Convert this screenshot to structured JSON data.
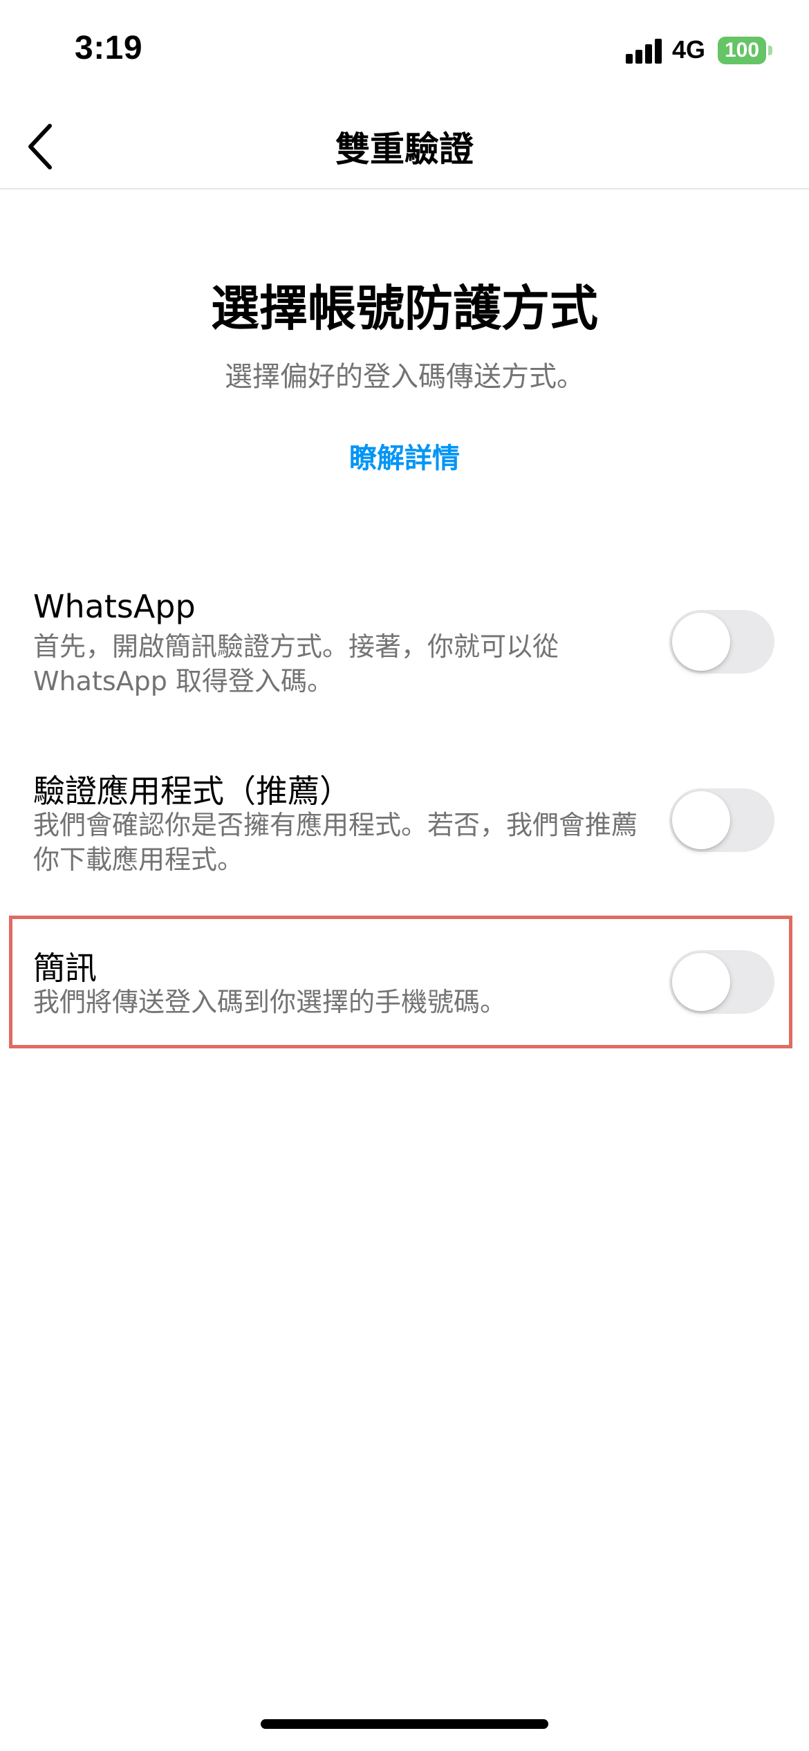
{
  "status_bar": {
    "time": "3:19",
    "network": "4G",
    "battery": "100",
    "colors": {
      "battery": "#65c466"
    }
  },
  "nav": {
    "back_icon": "chevron-left-icon",
    "title": "雙重驗證"
  },
  "header": {
    "title": "選擇帳號防護方式",
    "subtitle": "選擇偏好的登入碼傳送方式。",
    "learn_more": "瞭解詳情",
    "link_color": "#0095f6"
  },
  "options": [
    {
      "title": "WhatsApp",
      "description": "首先，開啟簡訊驗證方式。接著，你就可以從 WhatsApp 取得登入碼。",
      "enabled": false
    },
    {
      "title": "驗證應用程式（推薦）",
      "description": "我們會確認你是否擁有應用程式。若否，我們會推薦你下載應用程式。",
      "enabled": false
    },
    {
      "title": "簡訊",
      "description": "我們將傳送登入碼到你選擇的手機號碼。",
      "enabled": false,
      "highlighted": true,
      "highlight_color": "#e06b62"
    }
  ]
}
